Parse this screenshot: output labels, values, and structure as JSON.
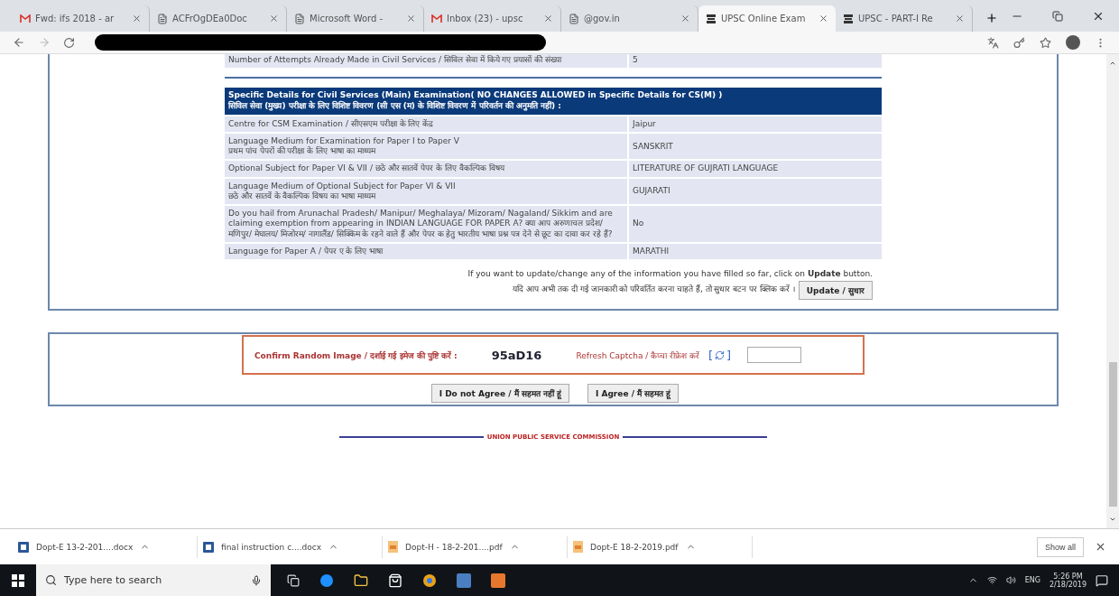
{
  "browser": {
    "tabs": [
      {
        "title": "Fwd: ifs 2018 - ar",
        "kind": "mail",
        "selected": false
      },
      {
        "title": "ACFrOgDEa0Doc",
        "kind": "doc",
        "selected": false
      },
      {
        "title": "Microsoft Word -",
        "kind": "doc",
        "selected": false
      },
      {
        "title": "Inbox (23) - upsc",
        "kind": "mail",
        "selected": false
      },
      {
        "title": "@gov.in",
        "kind": "doc",
        "selected": false
      },
      {
        "title": "UPSC Online Exam",
        "kind": "site",
        "selected": true
      },
      {
        "title": "UPSC - PART-I Re",
        "kind": "site",
        "selected": false
      }
    ]
  },
  "page": {
    "attempts_row": {
      "label": "Number of Attempts Already Made in Civil Services / सिविल सेवा में किये गए प्रयासों की संख्या",
      "value": "5"
    },
    "section_header": [
      "Specific Details for Civil Services (Main) Examination( NO CHANGES ALLOWED in Specific Details for CS(M) )",
      "सिविल सेवा (मुख्य) परीक्षा के लिए विशिष्ट विवरण (सी एस (म) के विशिष्ट विवरण में परिवर्तन की अनुमति नहीं) :"
    ],
    "rows": [
      {
        "label": [
          "Centre for CSM Examination / सीएसएम परीक्षा के लिए केंद्र"
        ],
        "value": "Jaipur"
      },
      {
        "label": [
          "Language Medium for Examination for Paper I to Paper V",
          "प्रथम पांच पेपरों की परीक्षा के लिए भाषा का माध्यम"
        ],
        "value": "SANSKRIT"
      },
      {
        "label": [
          "Optional Subject for Paper VI & VII / छठे और सातवें पेपर के लिए वैकल्पिक विषय"
        ],
        "value": "LITERATURE OF GUJRATI LANGUAGE"
      },
      {
        "label": [
          "Language Medium of Optional Subject for Paper VI & VII",
          "छठे और सातवें के वैकल्पिक विषय का भाषा माध्यम"
        ],
        "value": "GUJARATI"
      },
      {
        "label": [
          "Do you hail from Arunachal Pradesh/ Manipur/ Meghalaya/ Mizoram/ Nagaland/ Sikkim and are claiming exemption from appearing in INDIAN LANGUAGE FOR PAPER A? क्या आप अरुणाचल प्रदेश/ मणिपुर/ मेघालय/ मिजोरम/ नागालैंड/ सिक्किम के रहने वाले हैं और पेपर क हेतु भारतीय भाषा प्रश्न पत्र देने से छूट का दावा कर रहे हैं?"
        ],
        "value": "No"
      },
      {
        "label": [
          "Language for Paper A / पेपर ए के लिए भाषा"
        ],
        "value": "MARATHI"
      }
    ],
    "update_note": [
      "If you want to update/change any of the information you have filled so far, click on **Update** button.",
      "यदि आप अभी तक दी गई जानकारी को परिवर्तित करना चाहते हैं, तो सुधार बटन पर क्लिक करें ।"
    ],
    "update_button": "Update / सुधार",
    "captcha": {
      "label": "Confirm Random Image / दर्शाई गई इमेज की पुष्टि करें :",
      "code": "95aD16",
      "refresh": "Refresh Captcha / कैप्चा रीफ्रेश करें",
      "bracket_open": "[",
      "bracket_close": "]"
    },
    "buttons": [
      "I Do not Agree / मैं सहमत नहीं हूं",
      "I Agree / मैं सहमत हूं"
    ],
    "footer": "UNION PUBLIC SERVICE COMMISSION"
  },
  "downloads": {
    "items": [
      {
        "name": "Dopt-E 13-2-201....docx",
        "kind": "docx"
      },
      {
        "name": "final instruction c....docx",
        "kind": "docx"
      },
      {
        "name": "Dopt-H - 18-2-201....pdf",
        "kind": "pdf"
      },
      {
        "name": "Dopt-E 18-2-2019.pdf",
        "kind": "pdf"
      }
    ],
    "show_all": "Show all"
  },
  "taskbar": {
    "search_placeholder": "Type here to search",
    "language": "ENG",
    "time": "5:26 PM",
    "date": "2/18/2019"
  }
}
